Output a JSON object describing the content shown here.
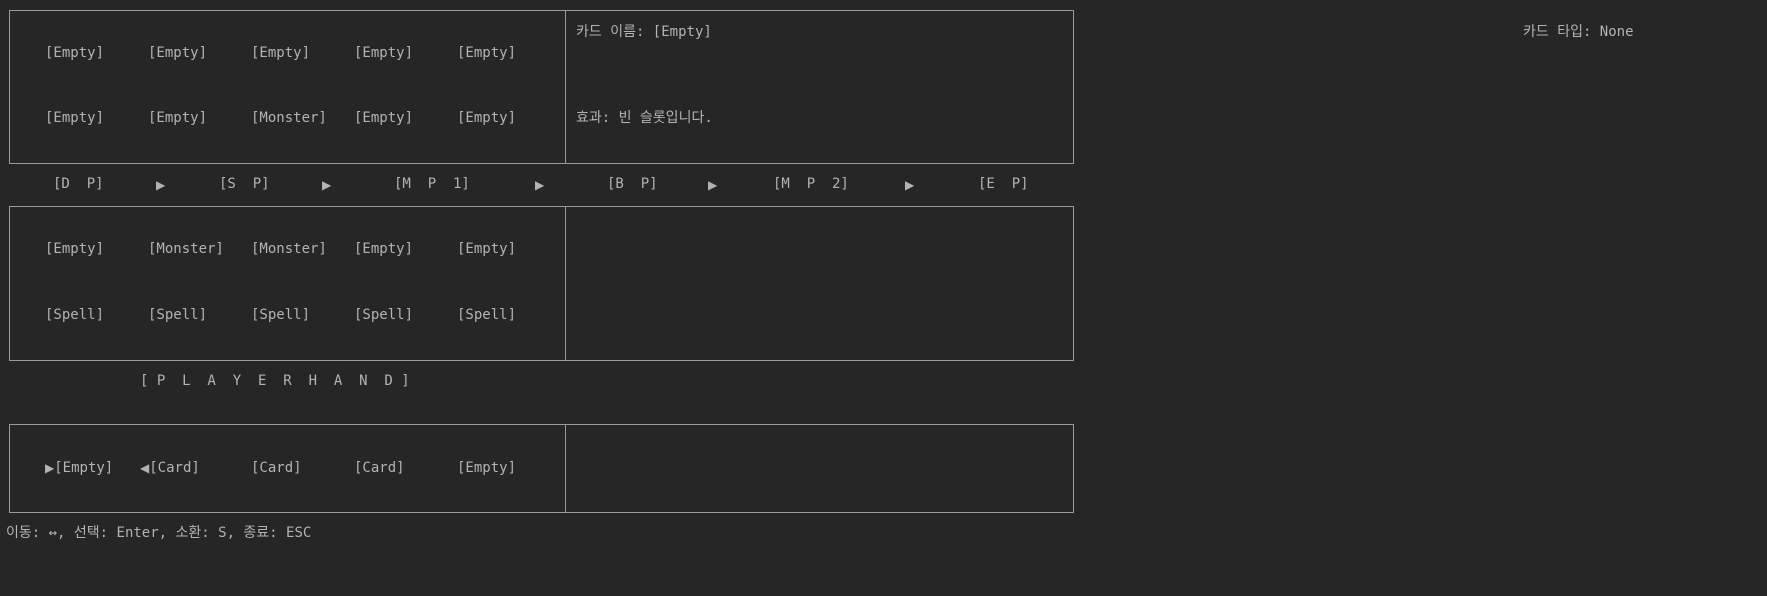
{
  "opponent_field": {
    "row1": [
      "[Empty]",
      "[Empty]",
      "[Empty]",
      "[Empty]",
      "[Empty]"
    ],
    "row2": [
      "[Empty]",
      "[Empty]",
      "[Monster]",
      "[Empty]",
      "[Empty]"
    ]
  },
  "card_info": {
    "name_text": "카드 이름: [Empty]",
    "type_text": "카드 타입: None",
    "effect_text": "효과: 빈 슬롯입니다."
  },
  "phases": [
    "[D  P]",
    "[S  P]",
    "[M  P  1]",
    "[B  P]",
    "[M  P  2]",
    "[E  P]"
  ],
  "phase_arrow": "▶",
  "player_field": {
    "row1": [
      "[Empty]",
      "[Monster]",
      "[Monster]",
      "[Empty]",
      "[Empty]"
    ],
    "row2": [
      "[Spell]",
      "[Spell]",
      "[Spell]",
      "[Spell]",
      "[Spell]"
    ]
  },
  "hand_title": "[ P  L  A  Y  E  R  H  A  N  D ]",
  "hand": {
    "cursor_left": "▶",
    "cursor_right": "◀",
    "slots": [
      "[Empty]",
      "[Card]",
      "[Card]",
      "[Card]",
      "[Empty]"
    ]
  },
  "help_text": "이동: ↔, 선택: Enter, 소환: S, 종료: ESC"
}
